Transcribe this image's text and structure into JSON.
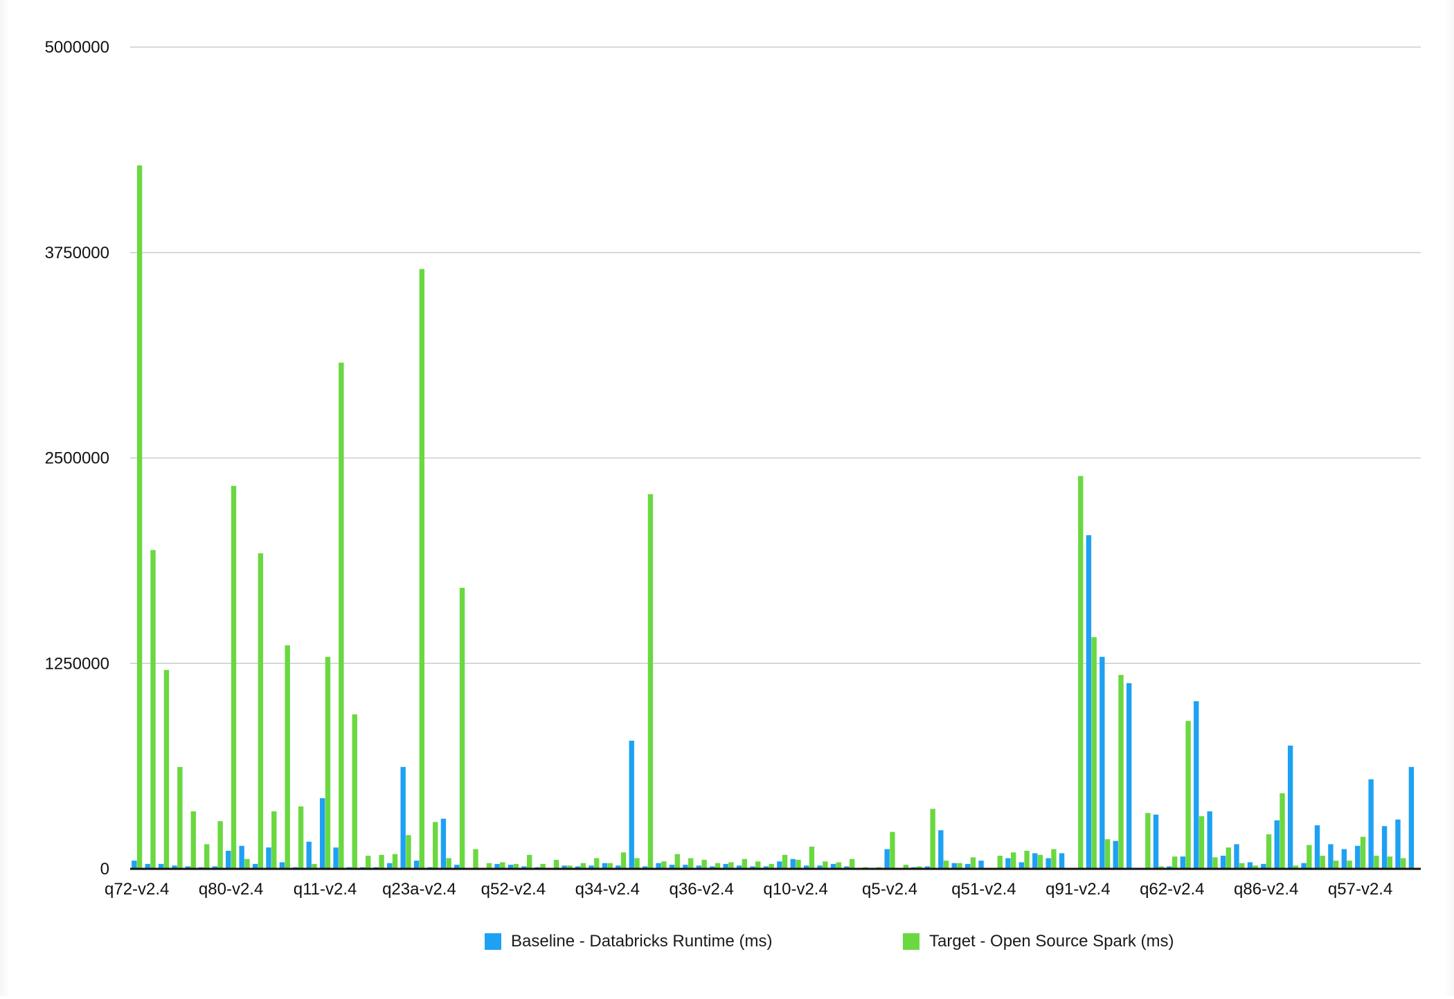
{
  "chart_data": {
    "type": "bar",
    "title": "",
    "xlabel": "",
    "ylabel": "",
    "ylim": [
      0,
      5000000
    ],
    "yticks": [
      0,
      1250000,
      2500000,
      3750000,
      5000000
    ],
    "ytick_labels": [
      "0",
      "1250000",
      "2500000",
      "3750000",
      "5000000"
    ],
    "grid": true,
    "legend_position": "bottom",
    "visible_category_labels": [
      "q72-v2.4",
      "q80-v2.4",
      "q11-v2.4",
      "q23a-v2.4",
      "q52-v2.4",
      "q34-v2.4",
      "q36-v2.4",
      "q10-v2.4",
      "q5-v2.4",
      "q51-v2.4",
      "q91-v2.4",
      "q62-v2.4",
      "q86-v2.4",
      "q57-v2.4"
    ],
    "label_every": 7,
    "series": [
      {
        "name": "Baseline - Databricks Runtime (ms)",
        "color": "#1ea1f2",
        "values": [
          50000,
          30000,
          30000,
          20000,
          15000,
          10000,
          15000,
          110000,
          140000,
          30000,
          130000,
          40000,
          10000,
          165000,
          430000,
          130000,
          10000,
          10000,
          10000,
          35000,
          620000,
          50000,
          10000,
          305000,
          25000,
          5000,
          5000,
          30000,
          25000,
          15000,
          10000,
          5000,
          20000,
          15000,
          20000,
          35000,
          20000,
          780000,
          15000,
          35000,
          25000,
          25000,
          20000,
          15000,
          30000,
          20000,
          15000,
          15000,
          45000,
          60000,
          20000,
          20000,
          30000,
          15000,
          5000,
          5000,
          120000,
          5000,
          10000,
          15000,
          235000,
          35000,
          30000,
          50000,
          5000,
          65000,
          40000,
          95000,
          65000,
          95000,
          5000,
          2030000,
          1290000,
          170000,
          1130000,
          5000,
          330000,
          15000,
          75000,
          1020000,
          350000,
          80000,
          150000,
          40000,
          30000,
          295000,
          750000,
          35000,
          265000,
          150000,
          120000,
          140000,
          545000,
          260000,
          300000,
          620000
        ]
      },
      {
        "name": "Target - Open Source Spark (ms)",
        "color": "#6ad840",
        "values": [
          4280000,
          1940000,
          1210000,
          620000,
          350000,
          150000,
          290000,
          2330000,
          60000,
          1920000,
          350000,
          1360000,
          380000,
          30000,
          1290000,
          3080000,
          940000,
          80000,
          85000,
          90000,
          205000,
          3650000,
          285000,
          65000,
          1710000,
          120000,
          35000,
          40000,
          30000,
          85000,
          30000,
          55000,
          20000,
          35000,
          65000,
          35000,
          100000,
          65000,
          2280000,
          45000,
          90000,
          65000,
          55000,
          35000,
          40000,
          60000,
          45000,
          30000,
          85000,
          55000,
          135000,
          45000,
          40000,
          60000,
          10000,
          10000,
          225000,
          25000,
          15000,
          365000,
          50000,
          35000,
          70000,
          5000,
          80000,
          100000,
          110000,
          85000,
          120000,
          5000,
          2390000,
          1410000,
          180000,
          1180000,
          5000,
          340000,
          15000,
          75000,
          900000,
          320000,
          70000,
          130000,
          35000,
          20000,
          210000,
          460000,
          20000,
          145000,
          80000,
          50000,
          50000,
          195000,
          80000,
          75000,
          65000
        ]
      }
    ]
  }
}
